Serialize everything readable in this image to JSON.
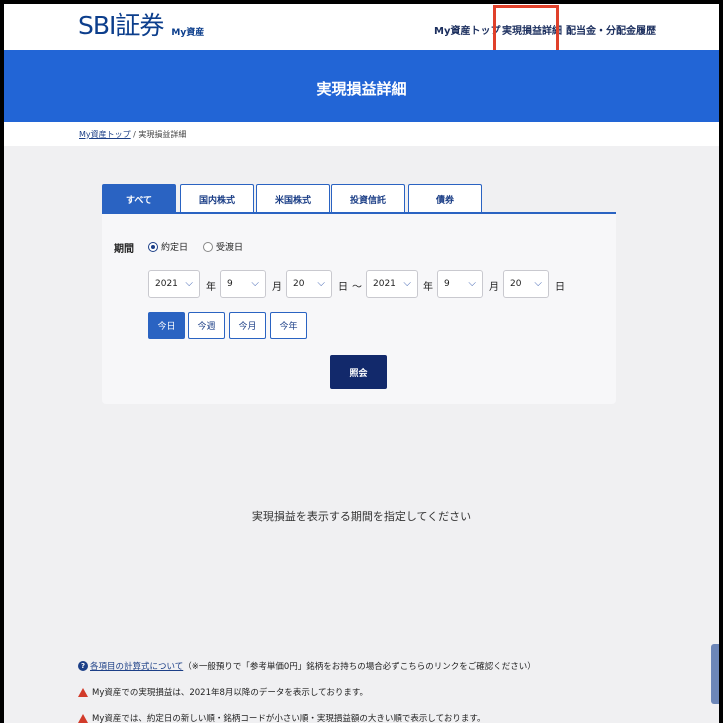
{
  "header": {
    "logo_main": "SBI証券",
    "logo_sub": "My資産",
    "nav": [
      {
        "label": "My資産トップ"
      },
      {
        "label": "実現損益詳細"
      },
      {
        "label": "配当金・分配金履歴"
      }
    ],
    "current_nav_index": 1,
    "highlight_color": "#e0402a"
  },
  "page": {
    "title": "実現損益詳細",
    "band_color": "#2265d6"
  },
  "breadcrumb": {
    "link": "My資産トップ",
    "separator": " / ",
    "current": "実現損益詳細"
  },
  "tabs": [
    {
      "label": "すべて",
      "active": true
    },
    {
      "label": "国内株式",
      "active": false
    },
    {
      "label": "米国株式",
      "active": false
    },
    {
      "label": "投資信託",
      "active": false
    },
    {
      "label": "債券",
      "active": false
    }
  ],
  "filter": {
    "period_label": "期間",
    "radios": [
      {
        "label": "約定日",
        "checked": true
      },
      {
        "label": "受渡日",
        "checked": false
      }
    ],
    "from": {
      "year": "2021",
      "month": "9",
      "day": "20"
    },
    "to": {
      "year": "2021",
      "month": "9",
      "day": "20"
    },
    "units": {
      "year": "年",
      "month": "月",
      "day": "日",
      "range": "～"
    },
    "quick": [
      {
        "label": "今日",
        "active": true
      },
      {
        "label": "今週",
        "active": false
      },
      {
        "label": "今月",
        "active": false
      },
      {
        "label": "今年",
        "active": false
      }
    ],
    "submit_label": "照会"
  },
  "empty_message": "実現損益を表示する期間を指定してください",
  "notes": {
    "calc_link": "各項目の計算式について",
    "calc_text": "（※一般預りで「参考単価0円」銘柄をお持ちの場合必ずこちらのリンクをご確認ください）",
    "warn1": "My資産での実現損益は、2021年8月以降のデータを表示しております。",
    "warn2": "My資産では、約定日の新しい順・銘柄コードが小さい順・実現損益額の大きい順で表示しております。"
  }
}
